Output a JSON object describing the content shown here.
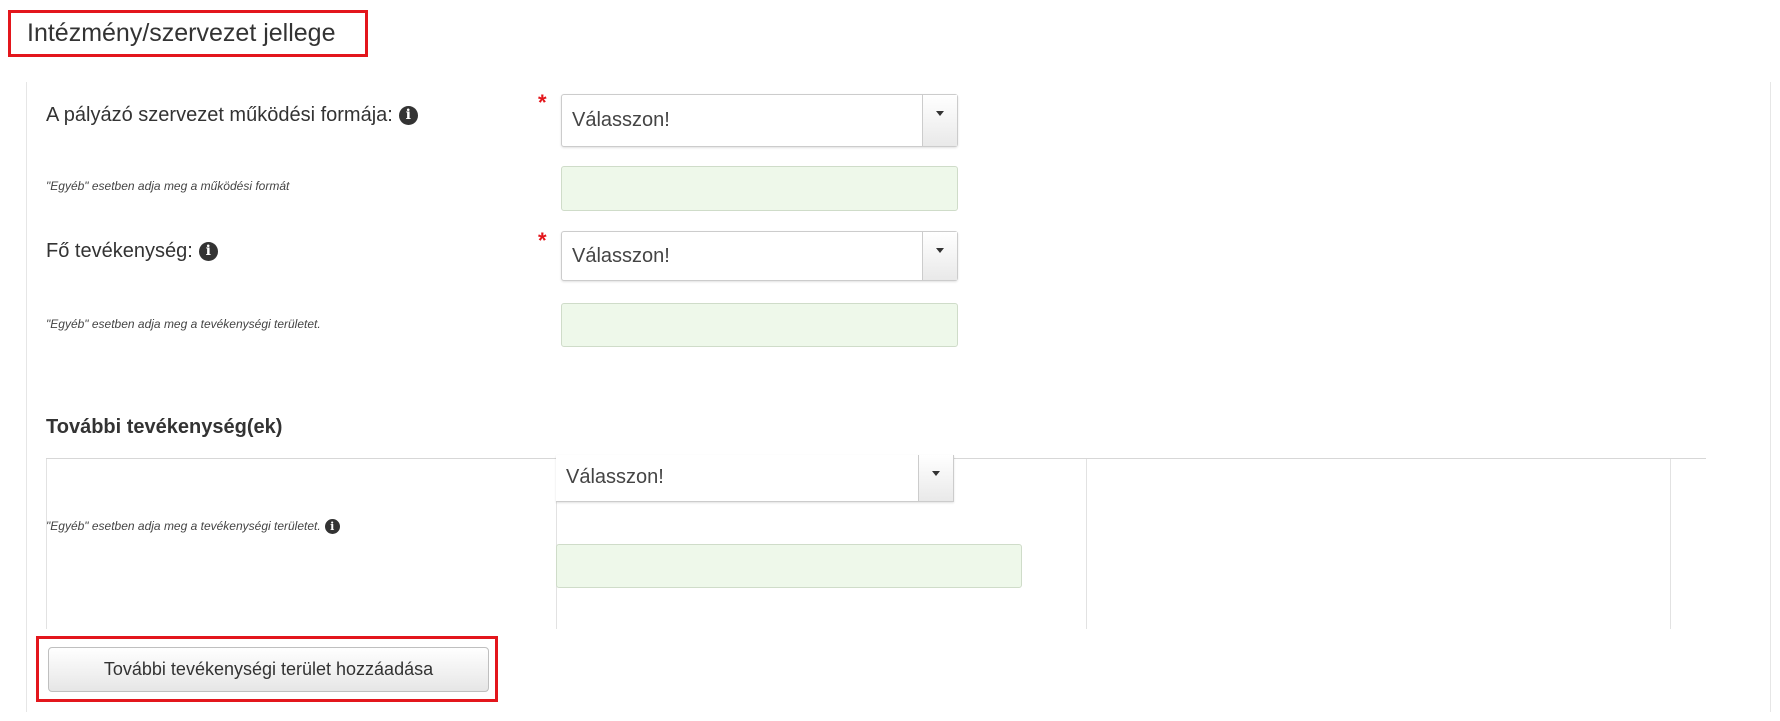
{
  "section": {
    "title": "Intézmény/szervezet jellege"
  },
  "operating_form": {
    "label": "A pályázó szervezet működési formája:",
    "required_mark": "*",
    "select_value": "Válasszon!",
    "other_hint": "\"Egyéb\" esetben adja meg a működési formát"
  },
  "main_activity": {
    "label": "Fő tevékenység:",
    "required_mark": "*",
    "select_value": "Válasszon!",
    "other_hint": "\"Egyéb\" esetben adja meg a tevékenységi területet."
  },
  "additional_activities": {
    "heading": "További tevékenység(ek)",
    "row_hint": "\"Egyéb\" esetben adja meg a tevékenységi területet.",
    "select_value": "Válasszon!",
    "add_button_label": "További tevékenységi terület hozzáadása"
  },
  "icons": {
    "info": "info-circle-icon",
    "dropdown": "caret-down-icon"
  },
  "colors": {
    "highlight": "#e3161c",
    "input_bg": "#eef8ea",
    "required": "#e3161c"
  }
}
